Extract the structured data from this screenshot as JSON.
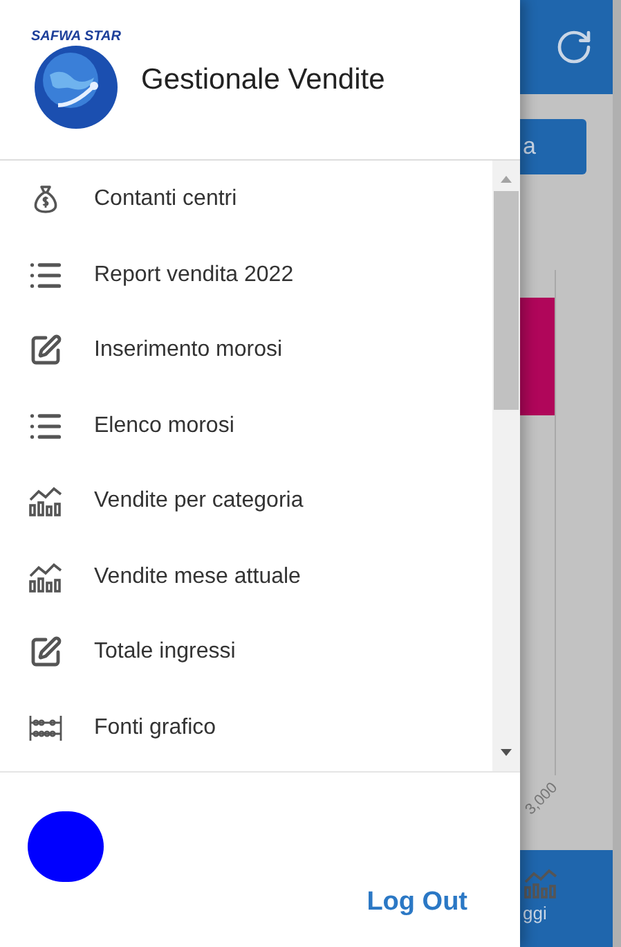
{
  "drawer": {
    "logo_text": "SAFWA STAR",
    "title": "Gestionale Vendite",
    "menu": [
      {
        "label": "Contanti centri",
        "kind": "bag"
      },
      {
        "label": "Report vendita 2022",
        "kind": "list"
      },
      {
        "label": "Inserimento morosi",
        "kind": "edit"
      },
      {
        "label": "Elenco morosi",
        "kind": "list"
      },
      {
        "label": "Vendite per categoria",
        "kind": "chart"
      },
      {
        "label": "Vendite mese attuale",
        "kind": "chart"
      },
      {
        "label": "Totale ingressi",
        "kind": "edit"
      },
      {
        "label": "Fonti grafico",
        "kind": "abacus"
      }
    ],
    "logout": "Log Out"
  },
  "background": {
    "button": "a",
    "axis_label": "3,000",
    "nav_label": "ggi"
  }
}
